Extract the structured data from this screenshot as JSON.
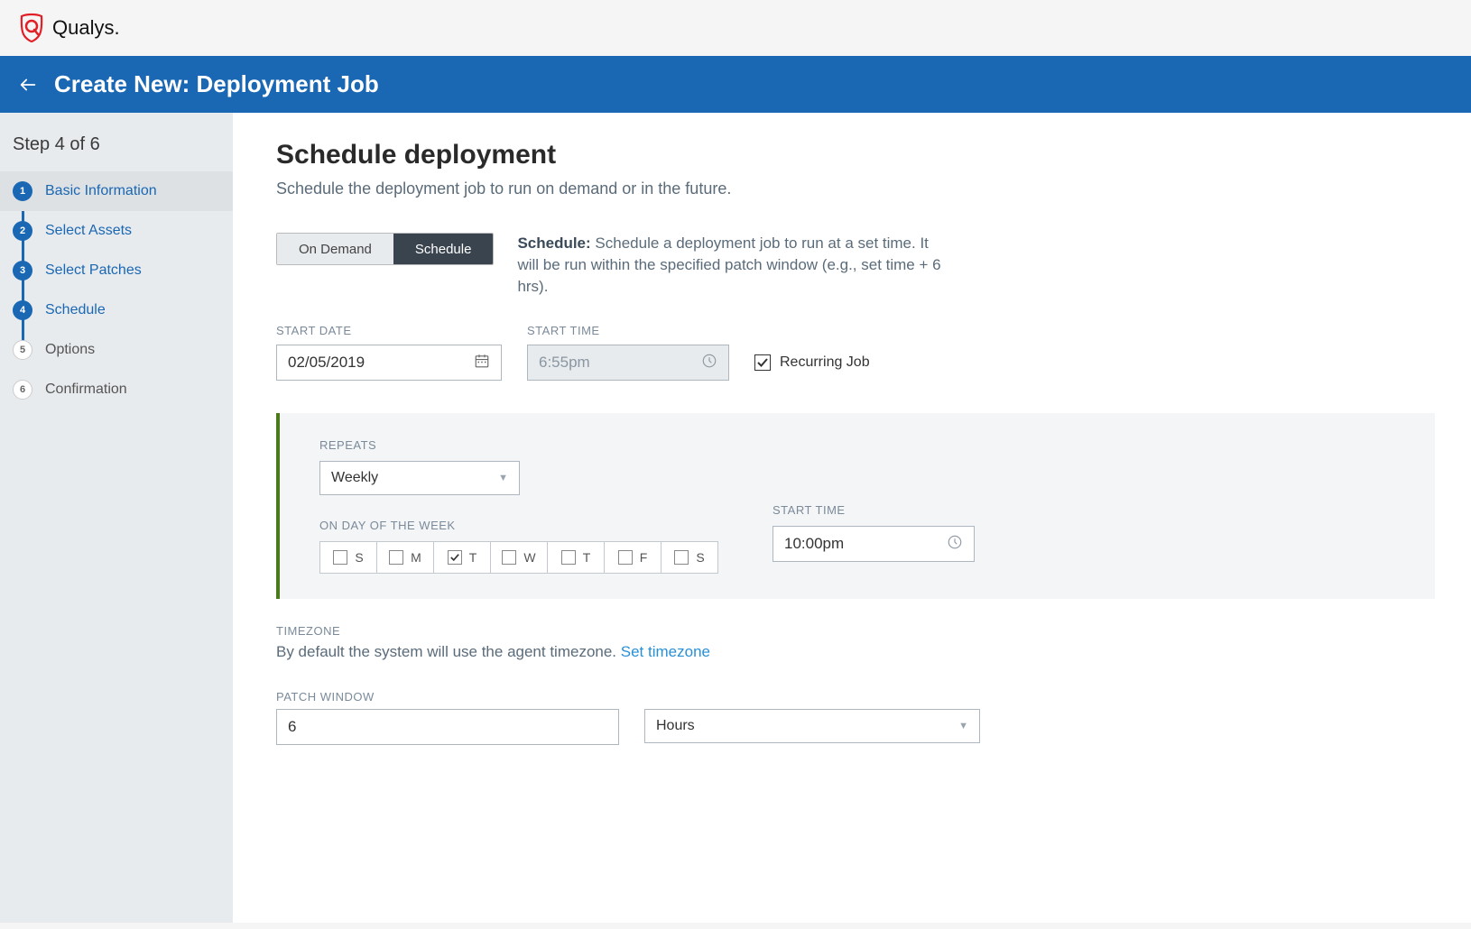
{
  "brand": "Qualys.",
  "header": {
    "title": "Create New: Deployment Job"
  },
  "sidebar": {
    "step_label": "Step 4 of 6",
    "steps": [
      {
        "num": "1",
        "label": "Basic Information",
        "state": "done"
      },
      {
        "num": "2",
        "label": "Select Assets",
        "state": "done"
      },
      {
        "num": "3",
        "label": "Select Patches",
        "state": "done"
      },
      {
        "num": "4",
        "label": "Schedule",
        "state": "current"
      },
      {
        "num": "5",
        "label": "Options",
        "state": "future"
      },
      {
        "num": "6",
        "label": "Confirmation",
        "state": "future"
      }
    ]
  },
  "main": {
    "title": "Schedule deployment",
    "subtitle": "Schedule the deployment job to run on demand or in the future.",
    "toggle": {
      "on_demand": "On Demand",
      "schedule": "Schedule"
    },
    "desc_label": "Schedule:",
    "desc_text": " Schedule a deployment job to run at a set time. It will be run within the specified patch window (e.g., set time + 6 hrs).",
    "start_date_label": "START DATE",
    "start_date_value": "02/05/2019",
    "start_time_label": "START TIME",
    "start_time_placeholder": "6:55pm",
    "recurring_label": "Recurring Job",
    "panel": {
      "repeats_label": "REPEATS",
      "repeats_value": "Weekly",
      "days_label": "ON DAY OF THE WEEK",
      "days": [
        "S",
        "M",
        "T",
        "W",
        "T",
        "F",
        "S"
      ],
      "days_checked": [
        false,
        false,
        true,
        false,
        false,
        false,
        false
      ],
      "start_time_label": "START TIME",
      "start_time_value": "10:00pm"
    },
    "timezone_label": "TIMEZONE",
    "timezone_text": "By default the system will use the agent timezone.  ",
    "timezone_link": "Set timezone",
    "patch_window_label": "PATCH WINDOW",
    "patch_window_value": "6",
    "patch_window_unit": "Hours"
  }
}
